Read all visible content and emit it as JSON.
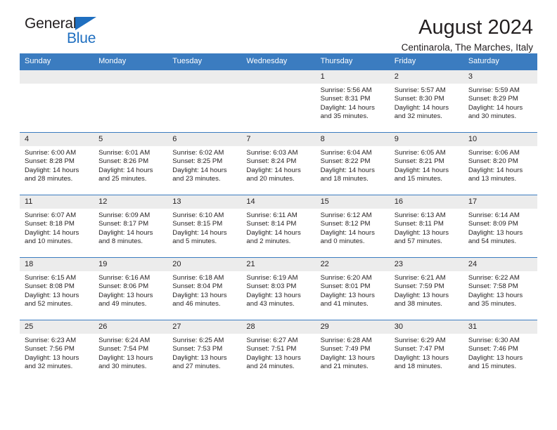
{
  "brand": {
    "name_top": "General",
    "name_bottom": "Blue",
    "triangle_icon": "blue-triangle-logo-mark",
    "accent_color": "#1f6fc0"
  },
  "header": {
    "title": "August 2024",
    "subtitle": "Centinarola, The Marches, Italy"
  },
  "calendar": {
    "header_bg": "#3b7cc0",
    "daynum_bg": "#ececec",
    "weekday_headers": [
      "Sunday",
      "Monday",
      "Tuesday",
      "Wednesday",
      "Thursday",
      "Friday",
      "Saturday"
    ],
    "weeks": [
      [
        {
          "day": "",
          "sunrise": "",
          "sunset": "",
          "daylight_line1": "",
          "daylight_line2": ""
        },
        {
          "day": "",
          "sunrise": "",
          "sunset": "",
          "daylight_line1": "",
          "daylight_line2": ""
        },
        {
          "day": "",
          "sunrise": "",
          "sunset": "",
          "daylight_line1": "",
          "daylight_line2": ""
        },
        {
          "day": "",
          "sunrise": "",
          "sunset": "",
          "daylight_line1": "",
          "daylight_line2": ""
        },
        {
          "day": "1",
          "sunrise": "Sunrise: 5:56 AM",
          "sunset": "Sunset: 8:31 PM",
          "daylight_line1": "Daylight: 14 hours",
          "daylight_line2": "and 35 minutes."
        },
        {
          "day": "2",
          "sunrise": "Sunrise: 5:57 AM",
          "sunset": "Sunset: 8:30 PM",
          "daylight_line1": "Daylight: 14 hours",
          "daylight_line2": "and 32 minutes."
        },
        {
          "day": "3",
          "sunrise": "Sunrise: 5:59 AM",
          "sunset": "Sunset: 8:29 PM",
          "daylight_line1": "Daylight: 14 hours",
          "daylight_line2": "and 30 minutes."
        }
      ],
      [
        {
          "day": "4",
          "sunrise": "Sunrise: 6:00 AM",
          "sunset": "Sunset: 8:28 PM",
          "daylight_line1": "Daylight: 14 hours",
          "daylight_line2": "and 28 minutes."
        },
        {
          "day": "5",
          "sunrise": "Sunrise: 6:01 AM",
          "sunset": "Sunset: 8:26 PM",
          "daylight_line1": "Daylight: 14 hours",
          "daylight_line2": "and 25 minutes."
        },
        {
          "day": "6",
          "sunrise": "Sunrise: 6:02 AM",
          "sunset": "Sunset: 8:25 PM",
          "daylight_line1": "Daylight: 14 hours",
          "daylight_line2": "and 23 minutes."
        },
        {
          "day": "7",
          "sunrise": "Sunrise: 6:03 AM",
          "sunset": "Sunset: 8:24 PM",
          "daylight_line1": "Daylight: 14 hours",
          "daylight_line2": "and 20 minutes."
        },
        {
          "day": "8",
          "sunrise": "Sunrise: 6:04 AM",
          "sunset": "Sunset: 8:22 PM",
          "daylight_line1": "Daylight: 14 hours",
          "daylight_line2": "and 18 minutes."
        },
        {
          "day": "9",
          "sunrise": "Sunrise: 6:05 AM",
          "sunset": "Sunset: 8:21 PM",
          "daylight_line1": "Daylight: 14 hours",
          "daylight_line2": "and 15 minutes."
        },
        {
          "day": "10",
          "sunrise": "Sunrise: 6:06 AM",
          "sunset": "Sunset: 8:20 PM",
          "daylight_line1": "Daylight: 14 hours",
          "daylight_line2": "and 13 minutes."
        }
      ],
      [
        {
          "day": "11",
          "sunrise": "Sunrise: 6:07 AM",
          "sunset": "Sunset: 8:18 PM",
          "daylight_line1": "Daylight: 14 hours",
          "daylight_line2": "and 10 minutes."
        },
        {
          "day": "12",
          "sunrise": "Sunrise: 6:09 AM",
          "sunset": "Sunset: 8:17 PM",
          "daylight_line1": "Daylight: 14 hours",
          "daylight_line2": "and 8 minutes."
        },
        {
          "day": "13",
          "sunrise": "Sunrise: 6:10 AM",
          "sunset": "Sunset: 8:15 PM",
          "daylight_line1": "Daylight: 14 hours",
          "daylight_line2": "and 5 minutes."
        },
        {
          "day": "14",
          "sunrise": "Sunrise: 6:11 AM",
          "sunset": "Sunset: 8:14 PM",
          "daylight_line1": "Daylight: 14 hours",
          "daylight_line2": "and 2 minutes."
        },
        {
          "day": "15",
          "sunrise": "Sunrise: 6:12 AM",
          "sunset": "Sunset: 8:12 PM",
          "daylight_line1": "Daylight: 14 hours",
          "daylight_line2": "and 0 minutes."
        },
        {
          "day": "16",
          "sunrise": "Sunrise: 6:13 AM",
          "sunset": "Sunset: 8:11 PM",
          "daylight_line1": "Daylight: 13 hours",
          "daylight_line2": "and 57 minutes."
        },
        {
          "day": "17",
          "sunrise": "Sunrise: 6:14 AM",
          "sunset": "Sunset: 8:09 PM",
          "daylight_line1": "Daylight: 13 hours",
          "daylight_line2": "and 54 minutes."
        }
      ],
      [
        {
          "day": "18",
          "sunrise": "Sunrise: 6:15 AM",
          "sunset": "Sunset: 8:08 PM",
          "daylight_line1": "Daylight: 13 hours",
          "daylight_line2": "and 52 minutes."
        },
        {
          "day": "19",
          "sunrise": "Sunrise: 6:16 AM",
          "sunset": "Sunset: 8:06 PM",
          "daylight_line1": "Daylight: 13 hours",
          "daylight_line2": "and 49 minutes."
        },
        {
          "day": "20",
          "sunrise": "Sunrise: 6:18 AM",
          "sunset": "Sunset: 8:04 PM",
          "daylight_line1": "Daylight: 13 hours",
          "daylight_line2": "and 46 minutes."
        },
        {
          "day": "21",
          "sunrise": "Sunrise: 6:19 AM",
          "sunset": "Sunset: 8:03 PM",
          "daylight_line1": "Daylight: 13 hours",
          "daylight_line2": "and 43 minutes."
        },
        {
          "day": "22",
          "sunrise": "Sunrise: 6:20 AM",
          "sunset": "Sunset: 8:01 PM",
          "daylight_line1": "Daylight: 13 hours",
          "daylight_line2": "and 41 minutes."
        },
        {
          "day": "23",
          "sunrise": "Sunrise: 6:21 AM",
          "sunset": "Sunset: 7:59 PM",
          "daylight_line1": "Daylight: 13 hours",
          "daylight_line2": "and 38 minutes."
        },
        {
          "day": "24",
          "sunrise": "Sunrise: 6:22 AM",
          "sunset": "Sunset: 7:58 PM",
          "daylight_line1": "Daylight: 13 hours",
          "daylight_line2": "and 35 minutes."
        }
      ],
      [
        {
          "day": "25",
          "sunrise": "Sunrise: 6:23 AM",
          "sunset": "Sunset: 7:56 PM",
          "daylight_line1": "Daylight: 13 hours",
          "daylight_line2": "and 32 minutes."
        },
        {
          "day": "26",
          "sunrise": "Sunrise: 6:24 AM",
          "sunset": "Sunset: 7:54 PM",
          "daylight_line1": "Daylight: 13 hours",
          "daylight_line2": "and 30 minutes."
        },
        {
          "day": "27",
          "sunrise": "Sunrise: 6:25 AM",
          "sunset": "Sunset: 7:53 PM",
          "daylight_line1": "Daylight: 13 hours",
          "daylight_line2": "and 27 minutes."
        },
        {
          "day": "28",
          "sunrise": "Sunrise: 6:27 AM",
          "sunset": "Sunset: 7:51 PM",
          "daylight_line1": "Daylight: 13 hours",
          "daylight_line2": "and 24 minutes."
        },
        {
          "day": "29",
          "sunrise": "Sunrise: 6:28 AM",
          "sunset": "Sunset: 7:49 PM",
          "daylight_line1": "Daylight: 13 hours",
          "daylight_line2": "and 21 minutes."
        },
        {
          "day": "30",
          "sunrise": "Sunrise: 6:29 AM",
          "sunset": "Sunset: 7:47 PM",
          "daylight_line1": "Daylight: 13 hours",
          "daylight_line2": "and 18 minutes."
        },
        {
          "day": "31",
          "sunrise": "Sunrise: 6:30 AM",
          "sunset": "Sunset: 7:46 PM",
          "daylight_line1": "Daylight: 13 hours",
          "daylight_line2": "and 15 minutes."
        }
      ]
    ]
  }
}
